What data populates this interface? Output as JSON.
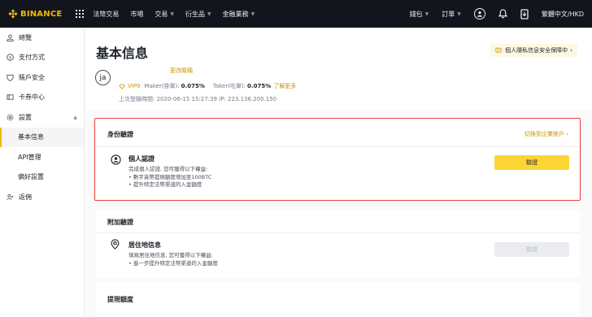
{
  "brand": {
    "name": "BINANCE",
    "color": "#f0b90b"
  },
  "nav": {
    "left": [
      {
        "label": "法幣交易",
        "caret": false
      },
      {
        "label": "市場",
        "caret": false
      },
      {
        "label": "交易",
        "caret": true
      },
      {
        "label": "衍生品",
        "caret": true
      },
      {
        "label": "金融業務",
        "caret": true
      }
    ],
    "right": {
      "wallet": "錢包",
      "orders": "訂單",
      "language": "繁體中文/HKD"
    }
  },
  "sidebar": {
    "items": [
      {
        "label": "總覽",
        "icon": "person-icon"
      },
      {
        "label": "支付方式",
        "icon": "dollar-icon"
      },
      {
        "label": "賬戶安全",
        "icon": "shield-icon"
      },
      {
        "label": "卡券中心",
        "icon": "ticket-icon"
      },
      {
        "label": "設置",
        "icon": "gear-icon"
      },
      {
        "label": "基本信息"
      },
      {
        "label": "API管理"
      },
      {
        "label": "偏好設置"
      },
      {
        "label": "返佣",
        "icon": "referral-icon"
      }
    ]
  },
  "header": {
    "title": "基本信息",
    "privacy_button": "個人隱私信息安全保障中",
    "avatar_text": "ja",
    "edit_nickname": "更改暱稱",
    "vip_label": "VIP0",
    "maker_label": "Maker(掛單):",
    "maker_value": "0.075%",
    "taker_label": "Taker(吃單):",
    "taker_value": "0.075%",
    "learn_more": "了解更多",
    "last_login": "上次登錄時間: 2020-06-15 15:27:39  IP: 223.136.200.150"
  },
  "identity": {
    "title": "身份驗證",
    "switch_link": "切換到企業賬戶",
    "item_name": "個人認證",
    "desc_intro": "完成個人認證, 您可獲得以下權益:",
    "benefits": [
      "• 數字貨幣提現額度增加至100BTC",
      "• 提升特定法幣渠道的入金額度"
    ],
    "button": "驗證"
  },
  "extra": {
    "title": "附加驗證",
    "item_name": "居住地信息",
    "desc_intro": "填寫居住地信息, 您可獲得以下權益:",
    "benefits": [
      "• 進一步提升特定法幣渠道的入金額度"
    ],
    "button": "驗證"
  },
  "withdraw": {
    "title": "提現額度"
  },
  "colors": {
    "accent": "#f0b90b",
    "button_primary": "#fcd535",
    "highlight_border": "#e5413d",
    "topbar": "#12161c"
  }
}
